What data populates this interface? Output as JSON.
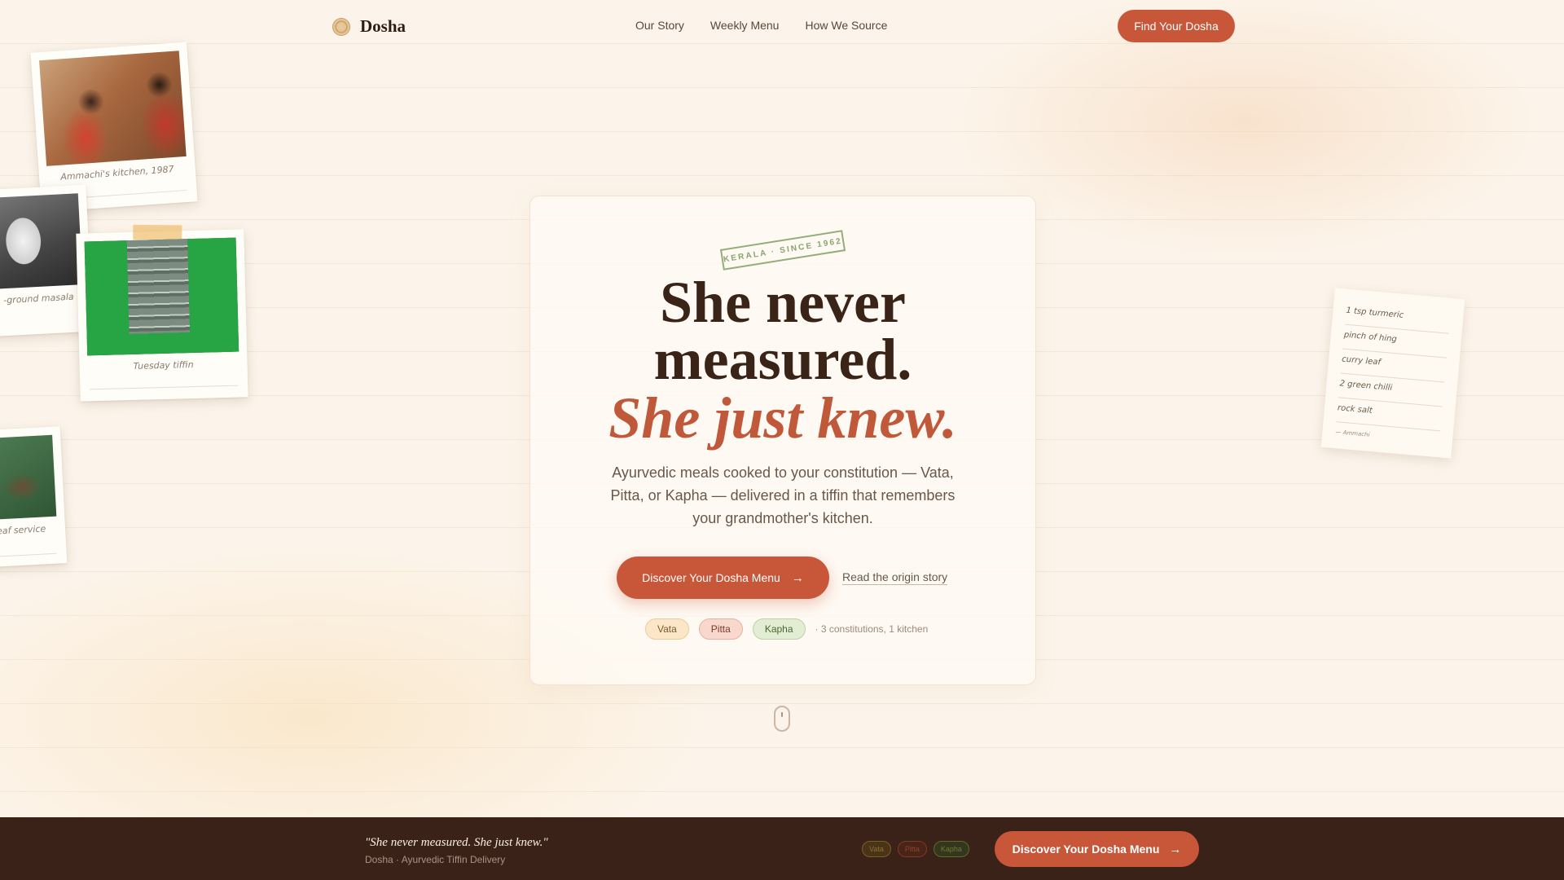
{
  "nav": {
    "brand": "Dosha",
    "links": [
      "Our Story",
      "Weekly Menu",
      "How We Source"
    ],
    "cta_label": "Find Your Dosha"
  },
  "polaroids": [
    {
      "caption": "Ammachi's kitchen, 1987"
    },
    {
      "caption": "-ground masala"
    },
    {
      "caption": "Tuesday tiffin"
    },
    {
      "caption": "eaf service"
    }
  ],
  "note": {
    "lines": [
      "1 tsp turmeric",
      "pinch of hing",
      "curry leaf",
      "2 green chilli",
      "rock salt"
    ],
    "signature": "— Ammachi"
  },
  "hero": {
    "stamp": "KERALA · SINCE 1962",
    "headline_line1": "She never",
    "headline_line2": "measured.",
    "headline_accent": "She just knew.",
    "subtext": "Ayurvedic meals cooked to your constitution — Vata, Pitta, or Kapha — delivered in a tiffin that remembers your grandmother's kitchen.",
    "cta_label": "Discover Your Dosha Menu",
    "cta_arrow": "→",
    "secondary_link": "Read the origin story",
    "chips": [
      "Vata",
      "Pitta",
      "Kapha"
    ],
    "chips_note": "· 3 constitutions, 1 kitchen"
  },
  "sticky_bar": {
    "quote": "\"She never measured. She just knew.\"",
    "subline": "Dosha · Ayurvedic Tiffin Delivery",
    "chips": [
      "Vata",
      "Pitta",
      "Kapha"
    ],
    "cta_label": "Discover Your Dosha Menu",
    "cta_arrow": "→"
  },
  "colors": {
    "accent": "#c8573a",
    "background": "#fcf4ea",
    "text_dark": "#3a2418",
    "bar_bg": "#3a2219"
  }
}
